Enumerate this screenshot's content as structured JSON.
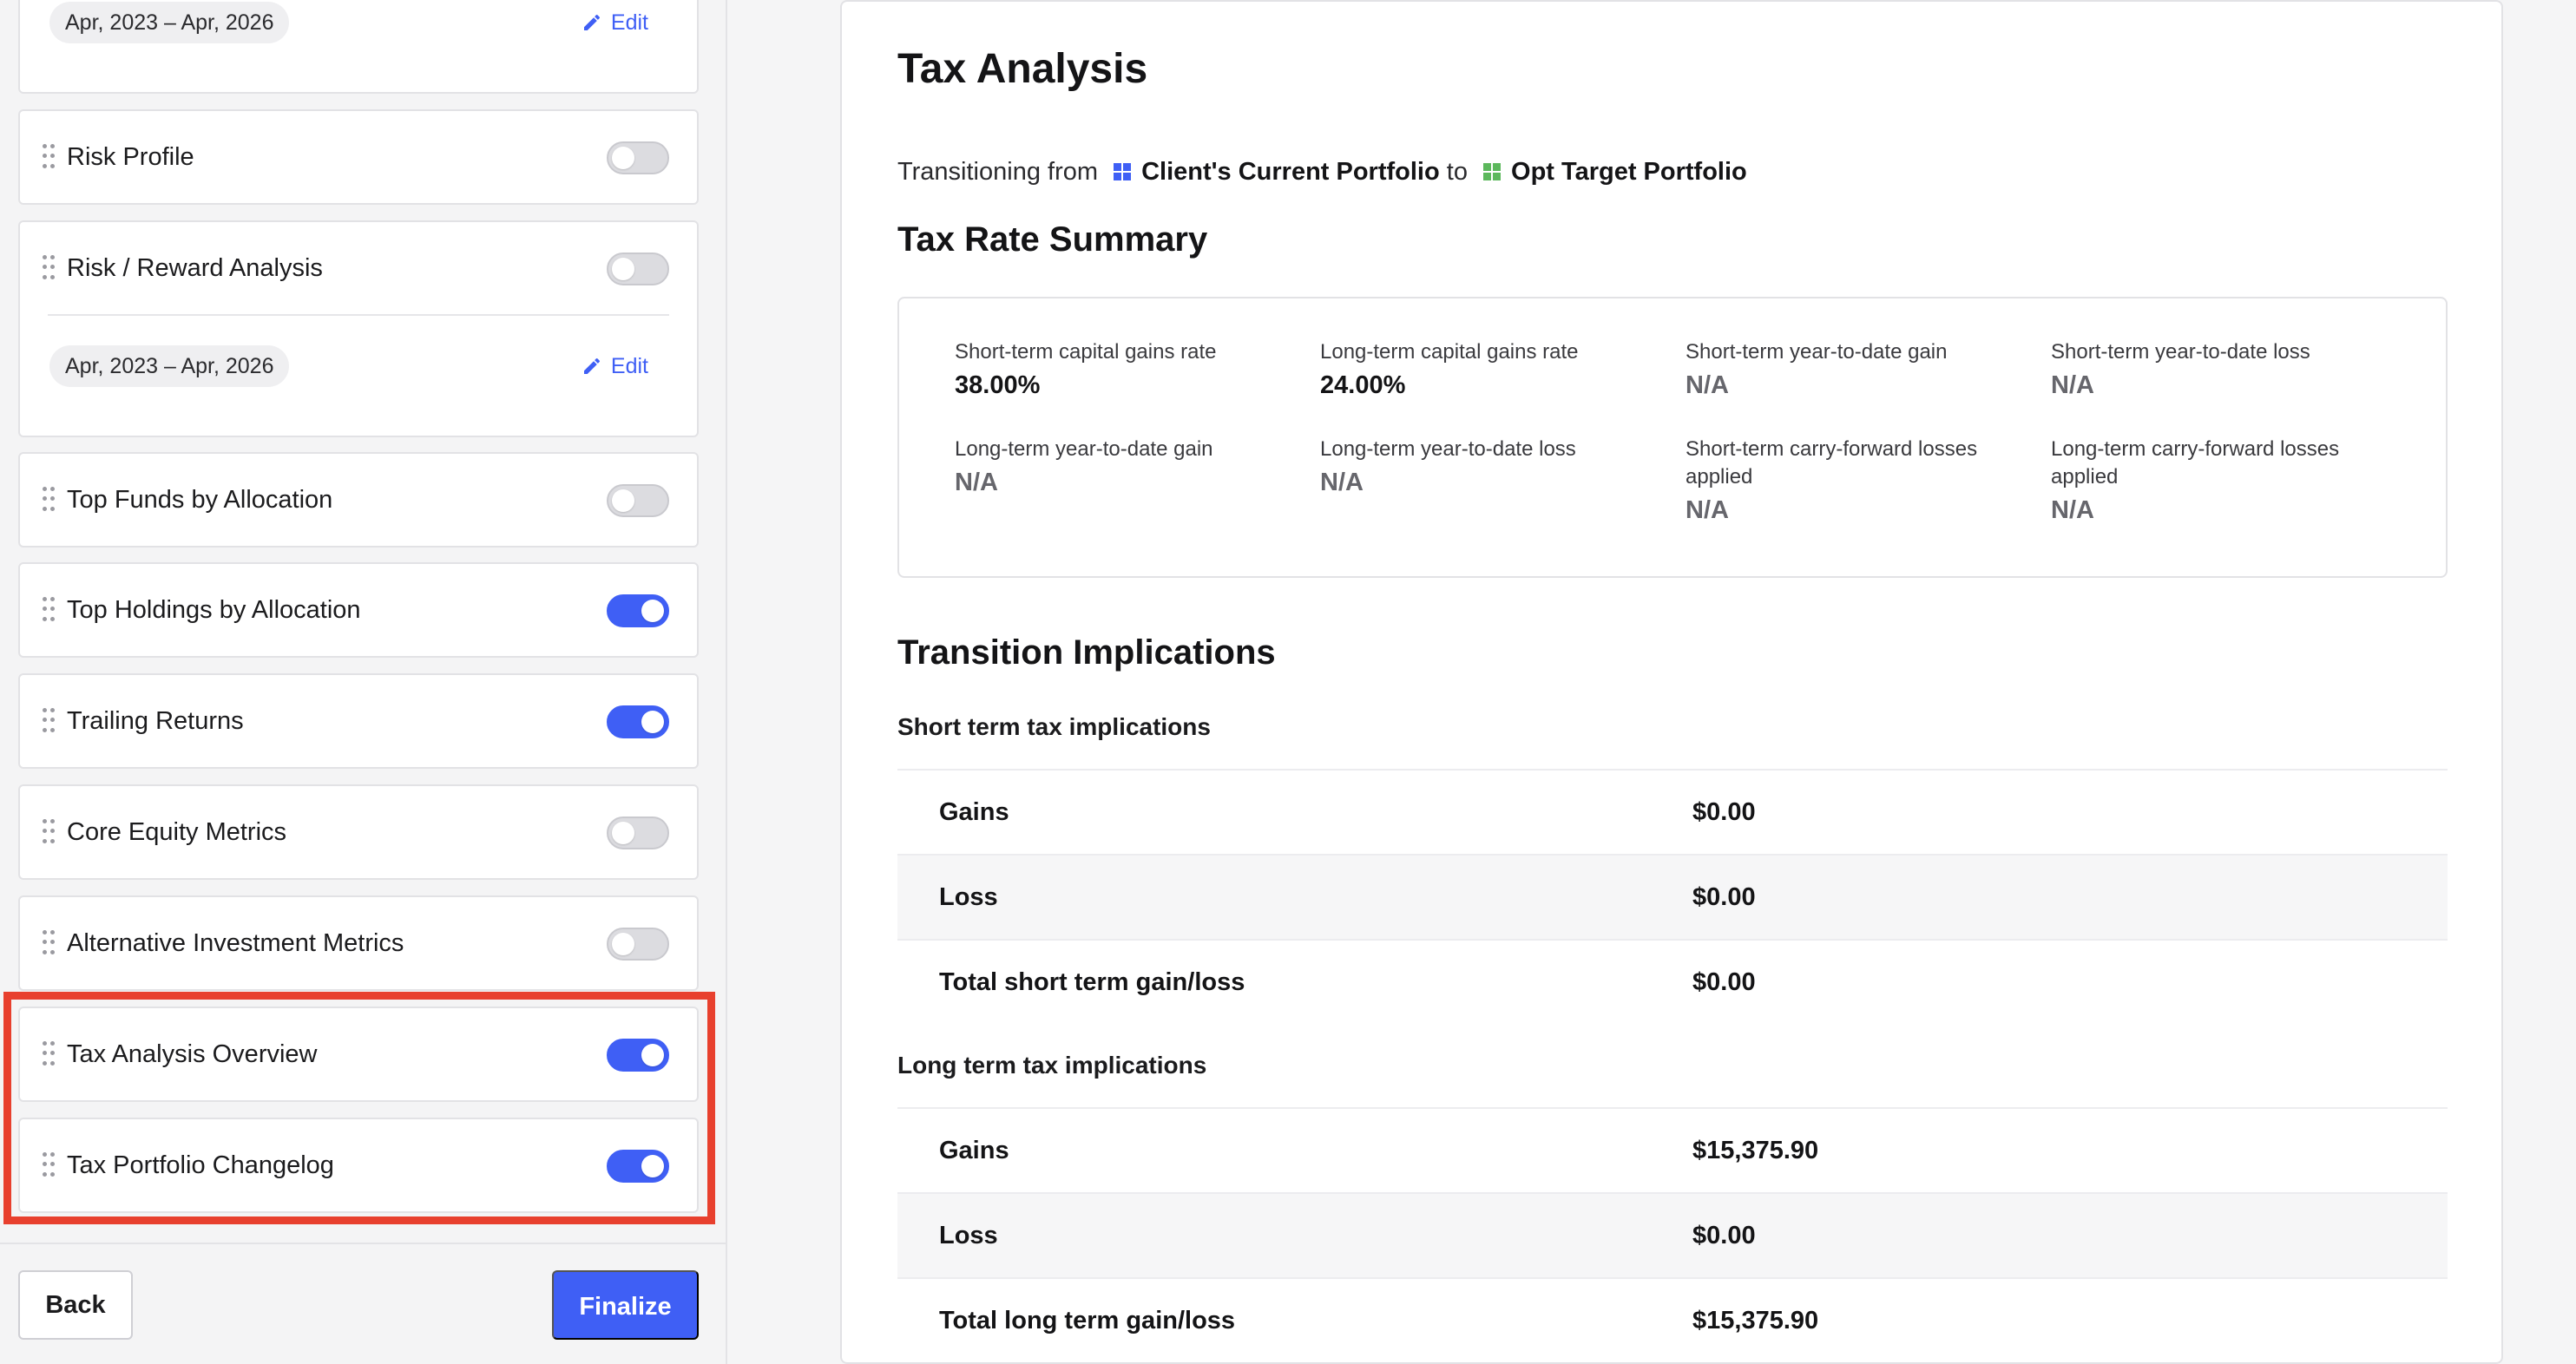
{
  "sidebar": {
    "top_card": {
      "date_range": "Apr, 2023 – Apr, 2026",
      "edit_label": "Edit"
    },
    "items": [
      {
        "label": "Risk Profile",
        "enabled": false
      },
      {
        "label": "Risk / Reward Analysis",
        "enabled": false,
        "date_range": "Apr, 2023 – Apr, 2026",
        "edit_label": "Edit"
      },
      {
        "label": "Top Funds by Allocation",
        "enabled": false
      },
      {
        "label": "Top Holdings by Allocation",
        "enabled": true
      },
      {
        "label": "Trailing Returns",
        "enabled": true
      },
      {
        "label": "Core Equity Metrics",
        "enabled": false
      },
      {
        "label": "Alternative Investment Metrics",
        "enabled": false
      },
      {
        "label": "Tax Analysis Overview",
        "enabled": true
      },
      {
        "label": "Tax Portfolio Changelog",
        "enabled": true
      }
    ],
    "back_label": "Back",
    "finalize_label": "Finalize"
  },
  "main": {
    "title": "Tax Analysis",
    "transition": {
      "prefix": "Transitioning from",
      "from_portfolio": "Client's Current Portfolio",
      "connector": "to",
      "to_portfolio": "Opt Target Portfolio"
    },
    "rate_summary": {
      "heading": "Tax Rate Summary",
      "metrics": [
        {
          "label": "Short-term capital gains rate",
          "value": "38.00%"
        },
        {
          "label": "Long-term capital gains rate",
          "value": "24.00%"
        },
        {
          "label": "Short-term year-to-date gain",
          "value": "N/A"
        },
        {
          "label": "Short-term year-to-date loss",
          "value": "N/A"
        },
        {
          "label": "Long-term year-to-date gain",
          "value": "N/A"
        },
        {
          "label": "Long-term year-to-date loss",
          "value": "N/A"
        },
        {
          "label_line1": "Short-term carry-forward losses",
          "label_line2": "applied",
          "value": "N/A"
        },
        {
          "label_line1": "Long-term carry-forward losses",
          "label_line2": "applied",
          "value": "N/A"
        }
      ]
    },
    "implications": {
      "heading": "Transition Implications",
      "short_term": {
        "heading": "Short term tax implications",
        "rows": [
          {
            "label": "Gains",
            "value": "$0.00"
          },
          {
            "label": "Loss",
            "value": "$0.00"
          },
          {
            "label": "Total short term gain/loss",
            "value": "$0.00"
          }
        ]
      },
      "long_term": {
        "heading": "Long term tax implications",
        "rows": [
          {
            "label": "Gains",
            "value": "$15,375.90"
          },
          {
            "label": "Loss",
            "value": "$0.00"
          },
          {
            "label": "Total long term gain/loss",
            "value": "$15,375.90"
          }
        ]
      }
    }
  },
  "colors": {
    "accent": "#3f5ff5",
    "highlight": "#e8402e",
    "from_portfolio_icon": "#3f5ff5",
    "to_portfolio_icon": "#5cb85c"
  }
}
